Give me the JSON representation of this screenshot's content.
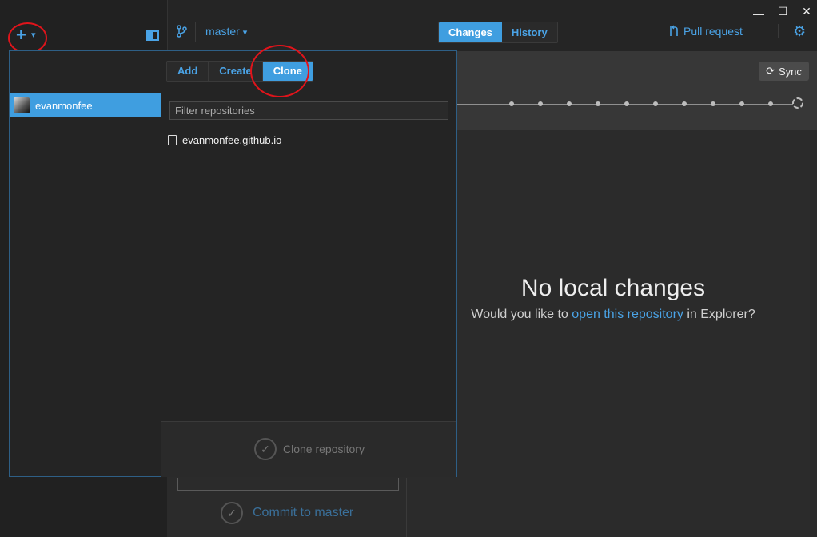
{
  "window": {
    "minimize_glyph": "—",
    "maximize_glyph": "☐",
    "close_glyph": "✕"
  },
  "toolbar": {
    "add_glyph": "+",
    "add_menu_caret": "▾",
    "branch": "master",
    "branch_caret": "▾",
    "tabs": [
      {
        "label": "Changes",
        "active": true
      },
      {
        "label": "History",
        "active": false
      }
    ],
    "pull_request": "Pull request",
    "sync": "Sync"
  },
  "main": {
    "empty_title": "No local changes",
    "empty_prefix": "Would you like to ",
    "empty_link": "open this repository",
    "empty_suffix": " in Explorer?"
  },
  "commit": {
    "label": "Commit to master"
  },
  "popover": {
    "account": "evanmonfee",
    "actions": [
      {
        "label": "Add",
        "active": false
      },
      {
        "label": "Create",
        "active": false
      },
      {
        "label": "Clone",
        "active": true
      }
    ],
    "filter_placeholder": "Filter repositories",
    "repositories": [
      "evanmonfee.github.io"
    ],
    "clone_button": "Clone repository"
  },
  "colors": {
    "accent": "#3f9ee0",
    "link": "#4aa3e6",
    "annotation_ring": "#e0141b"
  }
}
